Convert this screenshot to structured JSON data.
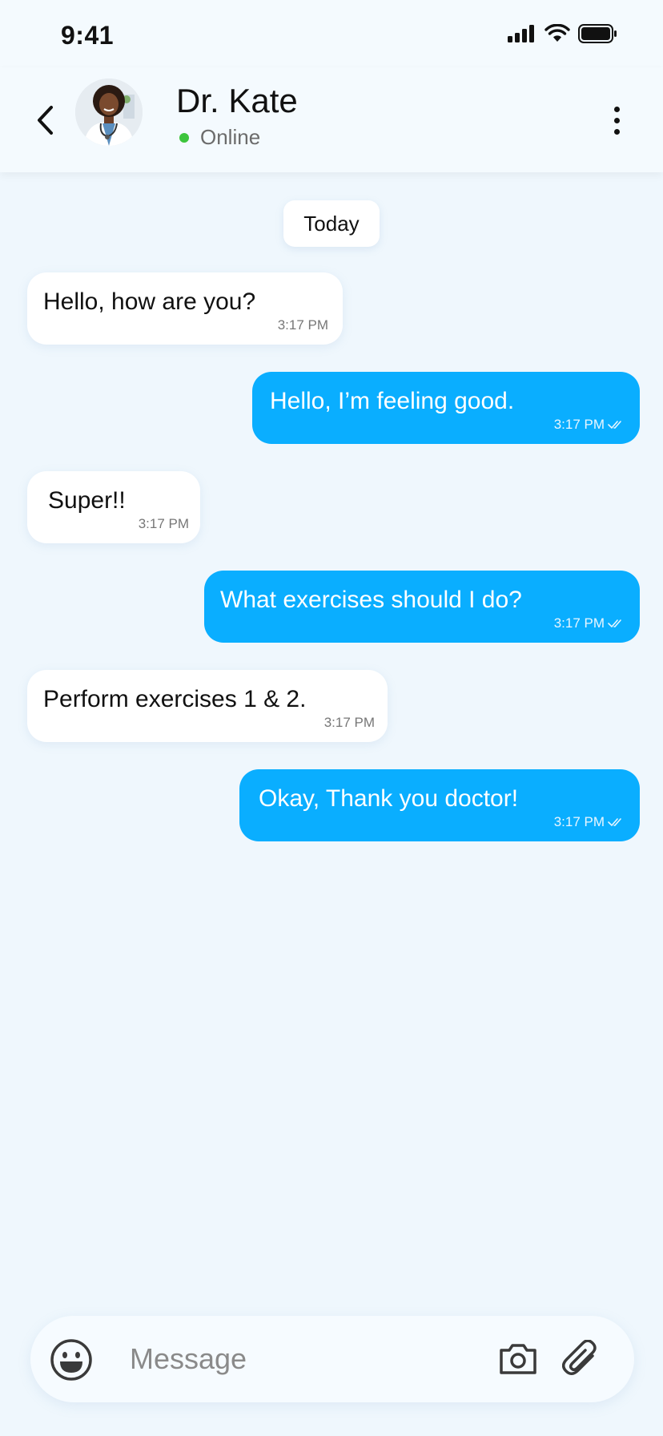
{
  "status_bar": {
    "time": "9:41",
    "icons": [
      "cellular-signal-icon",
      "wifi-icon",
      "battery-icon"
    ]
  },
  "header": {
    "contact_name": "Dr. Kate",
    "presence": "Online",
    "presence_color": "#3DC53D",
    "icons": [
      "chevron-left-icon",
      "more-vertical-icon"
    ]
  },
  "chat": {
    "date_label": "Today",
    "messages": [
      {
        "direction": "incoming",
        "text": "Hello, how are you?",
        "time": "3:17 PM"
      },
      {
        "direction": "outgoing",
        "text": "Hello, I’m feeling good.",
        "time": "3:17 PM",
        "status": "read"
      },
      {
        "direction": "incoming",
        "text": "Super!!",
        "time": "3:17 PM"
      },
      {
        "direction": "outgoing",
        "text": "What exercises should I do?",
        "time": "3:17 PM",
        "status": "read"
      },
      {
        "direction": "incoming",
        "text": "Perform exercises 1 & 2.",
        "time": "3:17 PM"
      },
      {
        "direction": "outgoing",
        "text": "Okay, Thank you doctor!",
        "time": "3:17 PM",
        "status": "read"
      }
    ]
  },
  "composer": {
    "placeholder": "Message",
    "icons": [
      "emoji-icon",
      "camera-icon",
      "paperclip-icon"
    ]
  },
  "colors": {
    "outgoing_bubble": "#0AAEFF",
    "incoming_bubble": "#FFFFFF",
    "background": "#EFF7FD"
  }
}
